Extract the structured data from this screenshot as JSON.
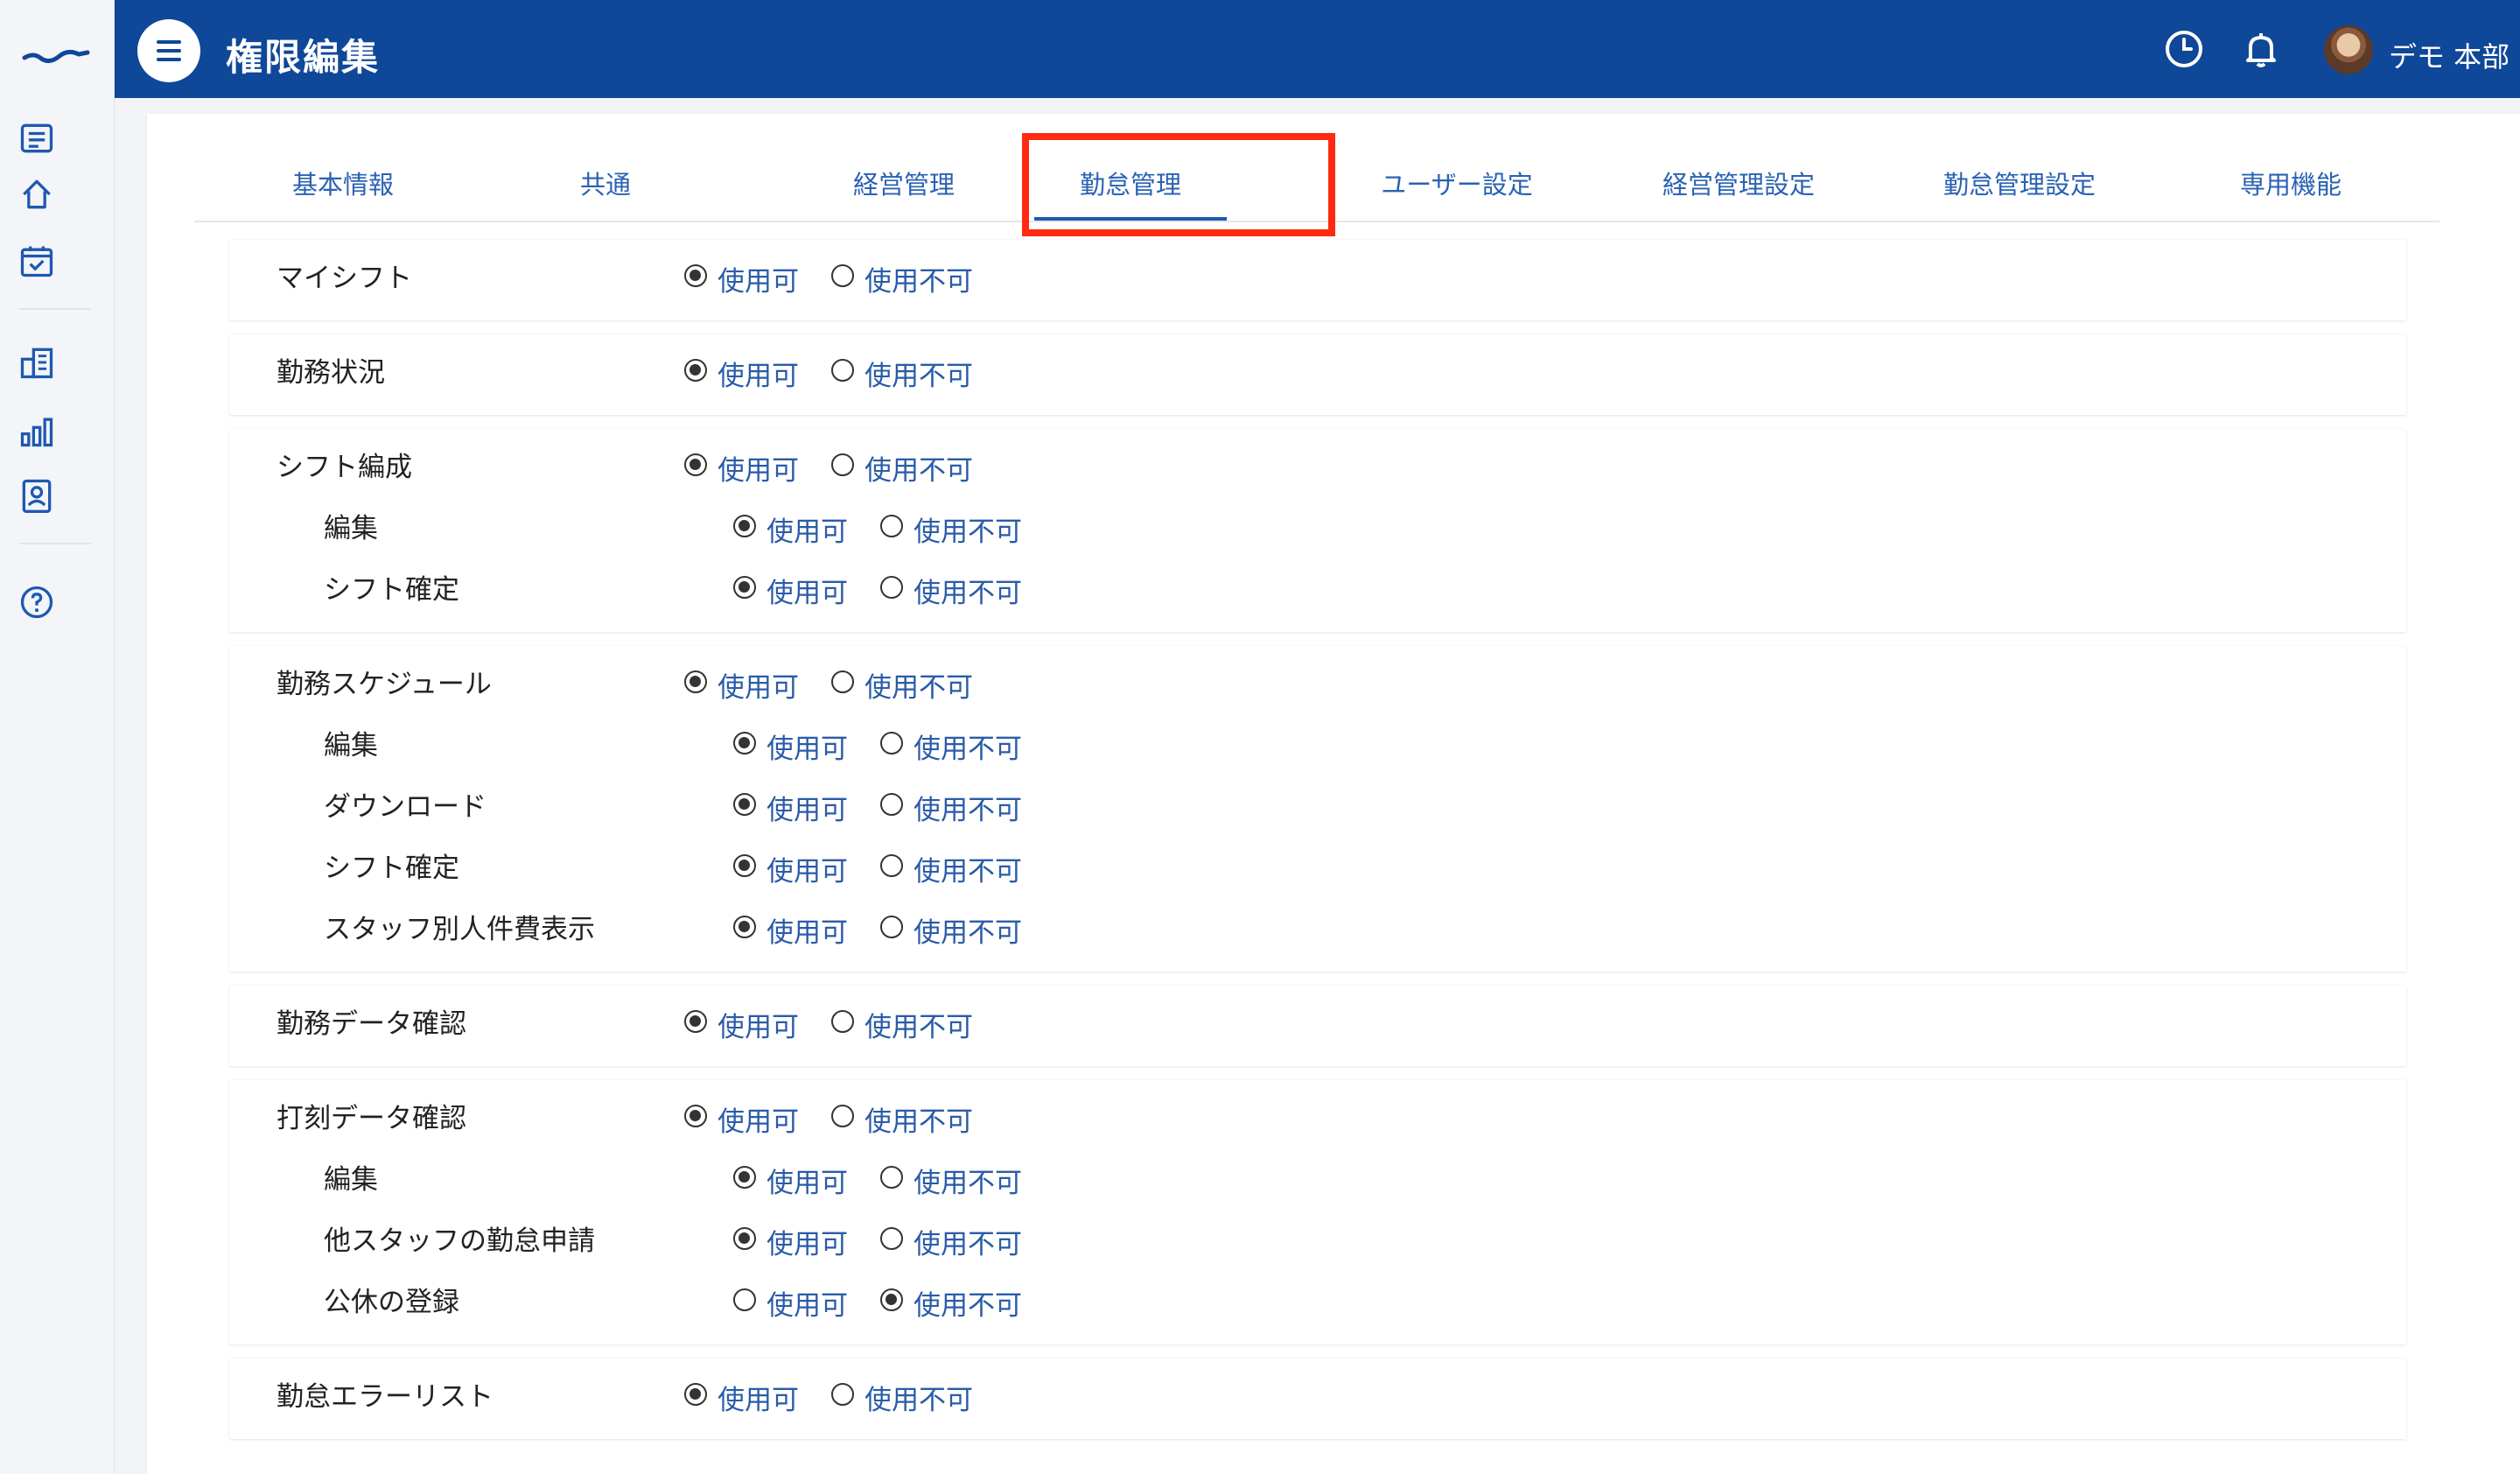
{
  "header": {
    "title": "権限編集",
    "user_name": "デモ 本部",
    "background": "#0f4799"
  },
  "rail_icons": [
    "logo-icon",
    "news-icon",
    "home-icon",
    "calendar-check-icon",
    "building-icon",
    "bar-chart-icon",
    "id-card-icon",
    "help-icon"
  ],
  "tabs": [
    {
      "label": "基本情報",
      "active": false
    },
    {
      "label": "共通",
      "active": false
    },
    {
      "label": "経営管理",
      "active": false
    },
    {
      "label": "勤怠管理",
      "active": true
    },
    {
      "label": "ユーザー設定",
      "active": false
    },
    {
      "label": "経営管理設定",
      "active": false
    },
    {
      "label": "勤怠管理設定",
      "active": false
    },
    {
      "label": "専用機能",
      "active": false
    }
  ],
  "option_labels": {
    "enabled": "使用可",
    "disabled": "使用不可"
  },
  "highlight_color": "#ff2a10",
  "sections": [
    {
      "rows": [
        {
          "label": "マイシフト",
          "value": "使用可",
          "sub": false
        }
      ]
    },
    {
      "rows": [
        {
          "label": "勤務状況",
          "value": "使用可",
          "sub": false
        }
      ]
    },
    {
      "rows": [
        {
          "label": "シフト編成",
          "value": "使用可",
          "sub": false
        },
        {
          "label": "編集",
          "value": "使用可",
          "sub": true
        },
        {
          "label": "シフト確定",
          "value": "使用可",
          "sub": true
        }
      ]
    },
    {
      "rows": [
        {
          "label": "勤務スケジュール",
          "value": "使用可",
          "sub": false
        },
        {
          "label": "編集",
          "value": "使用可",
          "sub": true
        },
        {
          "label": "ダウンロード",
          "value": "使用可",
          "sub": true
        },
        {
          "label": "シフト確定",
          "value": "使用可",
          "sub": true
        },
        {
          "label": "スタッフ別人件費表示",
          "value": "使用可",
          "sub": true
        }
      ]
    },
    {
      "rows": [
        {
          "label": "勤務データ確認",
          "value": "使用可",
          "sub": false
        }
      ]
    },
    {
      "rows": [
        {
          "label": "打刻データ確認",
          "value": "使用可",
          "sub": false
        },
        {
          "label": "編集",
          "value": "使用可",
          "sub": true
        },
        {
          "label": "他スタッフの勤怠申請",
          "value": "使用可",
          "sub": true
        },
        {
          "label": "公休の登録",
          "value": "使用不可",
          "sub": true
        }
      ]
    },
    {
      "rows": [
        {
          "label": "勤怠エラーリスト",
          "value": "使用可",
          "sub": false
        }
      ]
    }
  ]
}
